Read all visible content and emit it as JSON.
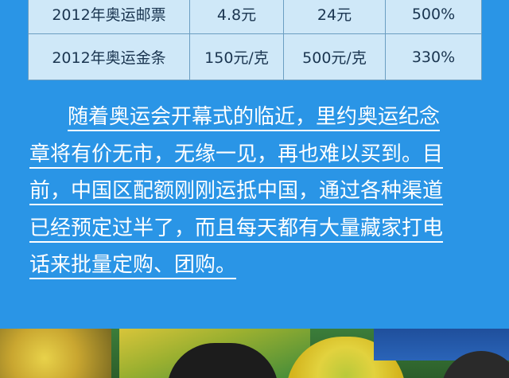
{
  "table": {
    "rows": [
      {
        "name": "2012年奥运邮票",
        "price1": "4.8元",
        "price2": "24元",
        "change": "500%"
      },
      {
        "name": "2012年奥运金条",
        "price1": "150元/克",
        "price2": "500元/克",
        "change": "330%"
      }
    ]
  },
  "article": {
    "lines": [
      "随着奥运会开幕式的临近，里约奥运纪念",
      "章将有价无市，无缘一见，再也难以买到。目",
      "前，中国区配额刚刚运抵中国，通过各种渠道",
      "已经预定过半了，而且每天都有大量藏家打电",
      "话来批量定购、团购。"
    ]
  },
  "colors": {
    "background": "#2a95e6",
    "table_bg": "#cfe8f8",
    "table_border": "#6b9ec2",
    "text_dark": "#1a3550",
    "text_light": "#ffffff"
  }
}
